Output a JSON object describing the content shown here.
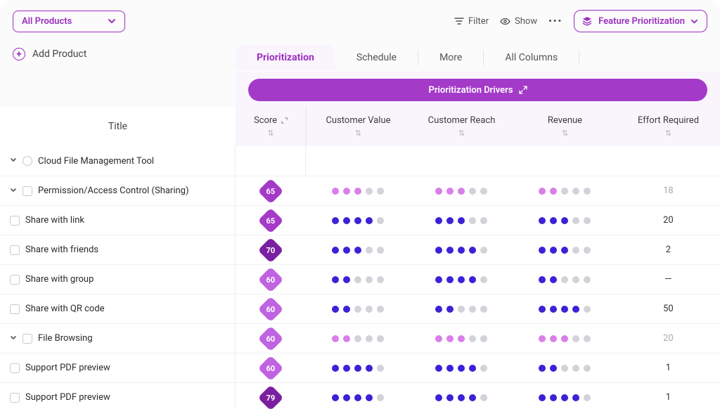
{
  "colors": {
    "brand": "#9b2fbf",
    "pill": "#a43ac8",
    "dot_on": "#3a22d6",
    "dot_mag": "#d97fe9",
    "dot_off": "#d2d2d8"
  },
  "top": {
    "product_selector": "All Products",
    "filter": "Filter",
    "show": "Show",
    "feature_btn": "Feature Prioritization"
  },
  "add_product": "Add Product",
  "tabs": [
    "Prioritization",
    "Schedule",
    "More",
    "All Columns"
  ],
  "active_tab": 0,
  "drivers_title": "Prioritization Drivers",
  "title_col": "Title",
  "columns": [
    "Score",
    "Customer Value",
    "Customer Reach",
    "Revenue",
    "Effort Required"
  ],
  "rows": [
    {
      "lvl": 0,
      "expander": true,
      "check": false,
      "circle": true,
      "title": "Cloud File Management Tool"
    },
    {
      "lvl": 1,
      "expander": true,
      "check": true,
      "title": "Permission/Access Control (Sharing)",
      "score": 65,
      "score_shade": "mid",
      "dot_color": "m",
      "vals": [
        3,
        3,
        2
      ],
      "effort": "18",
      "eff_dim": true
    },
    {
      "lvl": 2,
      "check": true,
      "title": "Share with link",
      "score": 65,
      "score_shade": "mid",
      "dot_color": "b",
      "vals": [
        4,
        3,
        3
      ],
      "effort": "20"
    },
    {
      "lvl": 2,
      "check": true,
      "title": "Share with friends",
      "score": 70,
      "score_shade": "dark",
      "dot_color": "b",
      "vals": [
        3,
        4,
        3
      ],
      "effort": "2"
    },
    {
      "lvl": 2,
      "check": true,
      "title": "Share with group",
      "score": 60,
      "score_shade": "light",
      "dot_color": "b",
      "vals": [
        2,
        4,
        2
      ],
      "effort": "—"
    },
    {
      "lvl": 2,
      "check": true,
      "title": "Share with QR code",
      "score": 60,
      "score_shade": "light",
      "dot_color": "b",
      "vals": [
        2,
        2,
        4
      ],
      "effort": "50"
    },
    {
      "lvl": 1,
      "expander": true,
      "check": true,
      "title": "File Browsing",
      "score": 60,
      "score_shade": "light",
      "dot_color": "m",
      "vals": [
        2,
        3,
        3
      ],
      "effort": "20",
      "eff_dim": true
    },
    {
      "lvl": 2,
      "check": true,
      "title": "Support PDF preview",
      "score": 60,
      "score_shade": "light",
      "dot_color": "b",
      "vals": [
        4,
        4,
        2
      ],
      "effort": "1"
    },
    {
      "lvl": 2,
      "check": true,
      "title": "Support PDF preview",
      "score": 79,
      "score_shade": "dark",
      "dot_color": "b",
      "vals": [
        4,
        4,
        4
      ],
      "effort": "1"
    }
  ]
}
